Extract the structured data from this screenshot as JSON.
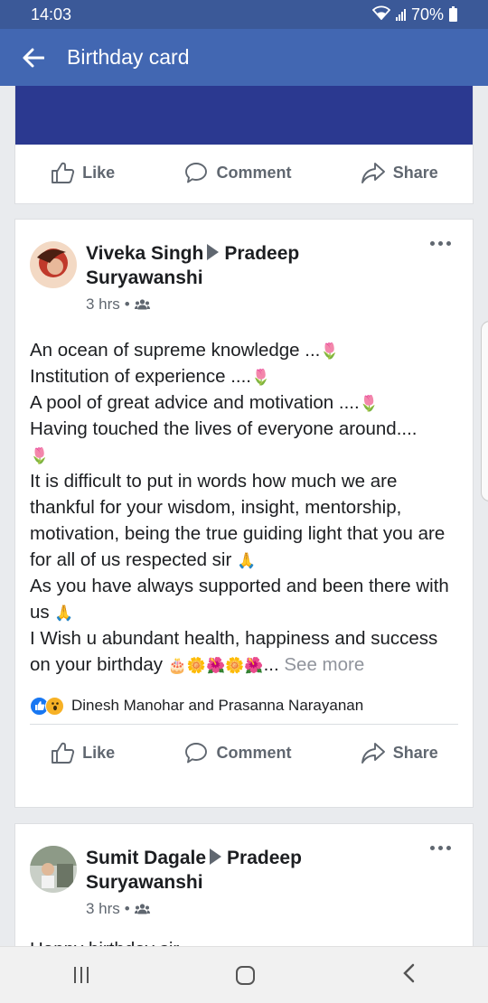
{
  "status": {
    "time": "14:03",
    "battery": "70%"
  },
  "app_bar": {
    "title": "Birthday card"
  },
  "actions": {
    "like": "Like",
    "comment": "Comment",
    "share": "Share"
  },
  "post1": {
    "author": "Viveka Singh",
    "target": "Pradeep Suryawanshi",
    "time": "3 hrs",
    "lines": {
      "l1": "An ocean of supreme knowledge ...",
      "l2": "Institution of experience ....",
      "l3": "A pool of great advice and motivation ....",
      "l4": "Having touched the lives of everyone around....",
      "l5": "It is difficult to put in words how much we are thankful for your wisdom, insight, mentorship, motivation, being the true guiding light that you are for all of us respected sir",
      "l6": "As you have always supported and been there with us",
      "l7": "I Wish u abundant health, happiness and success on your birthday",
      "ellipsis": "...",
      "see_more": "See more"
    },
    "reactions": "Dinesh Manohar and Prasanna Narayanan"
  },
  "post2": {
    "author": "Sumit Dagale",
    "target": "Pradeep Suryawanshi",
    "time": "3 hrs",
    "first_line": "Happy birthday sir"
  },
  "emoji": {
    "tulip": "🌷",
    "pray": "🙏",
    "cake": "🎂",
    "sunflower": "🌼",
    "hibiscus": "🌺"
  },
  "colors": {
    "appbar": "#4267b2",
    "statusbar": "#3b5998",
    "cover": "#2b3990"
  }
}
